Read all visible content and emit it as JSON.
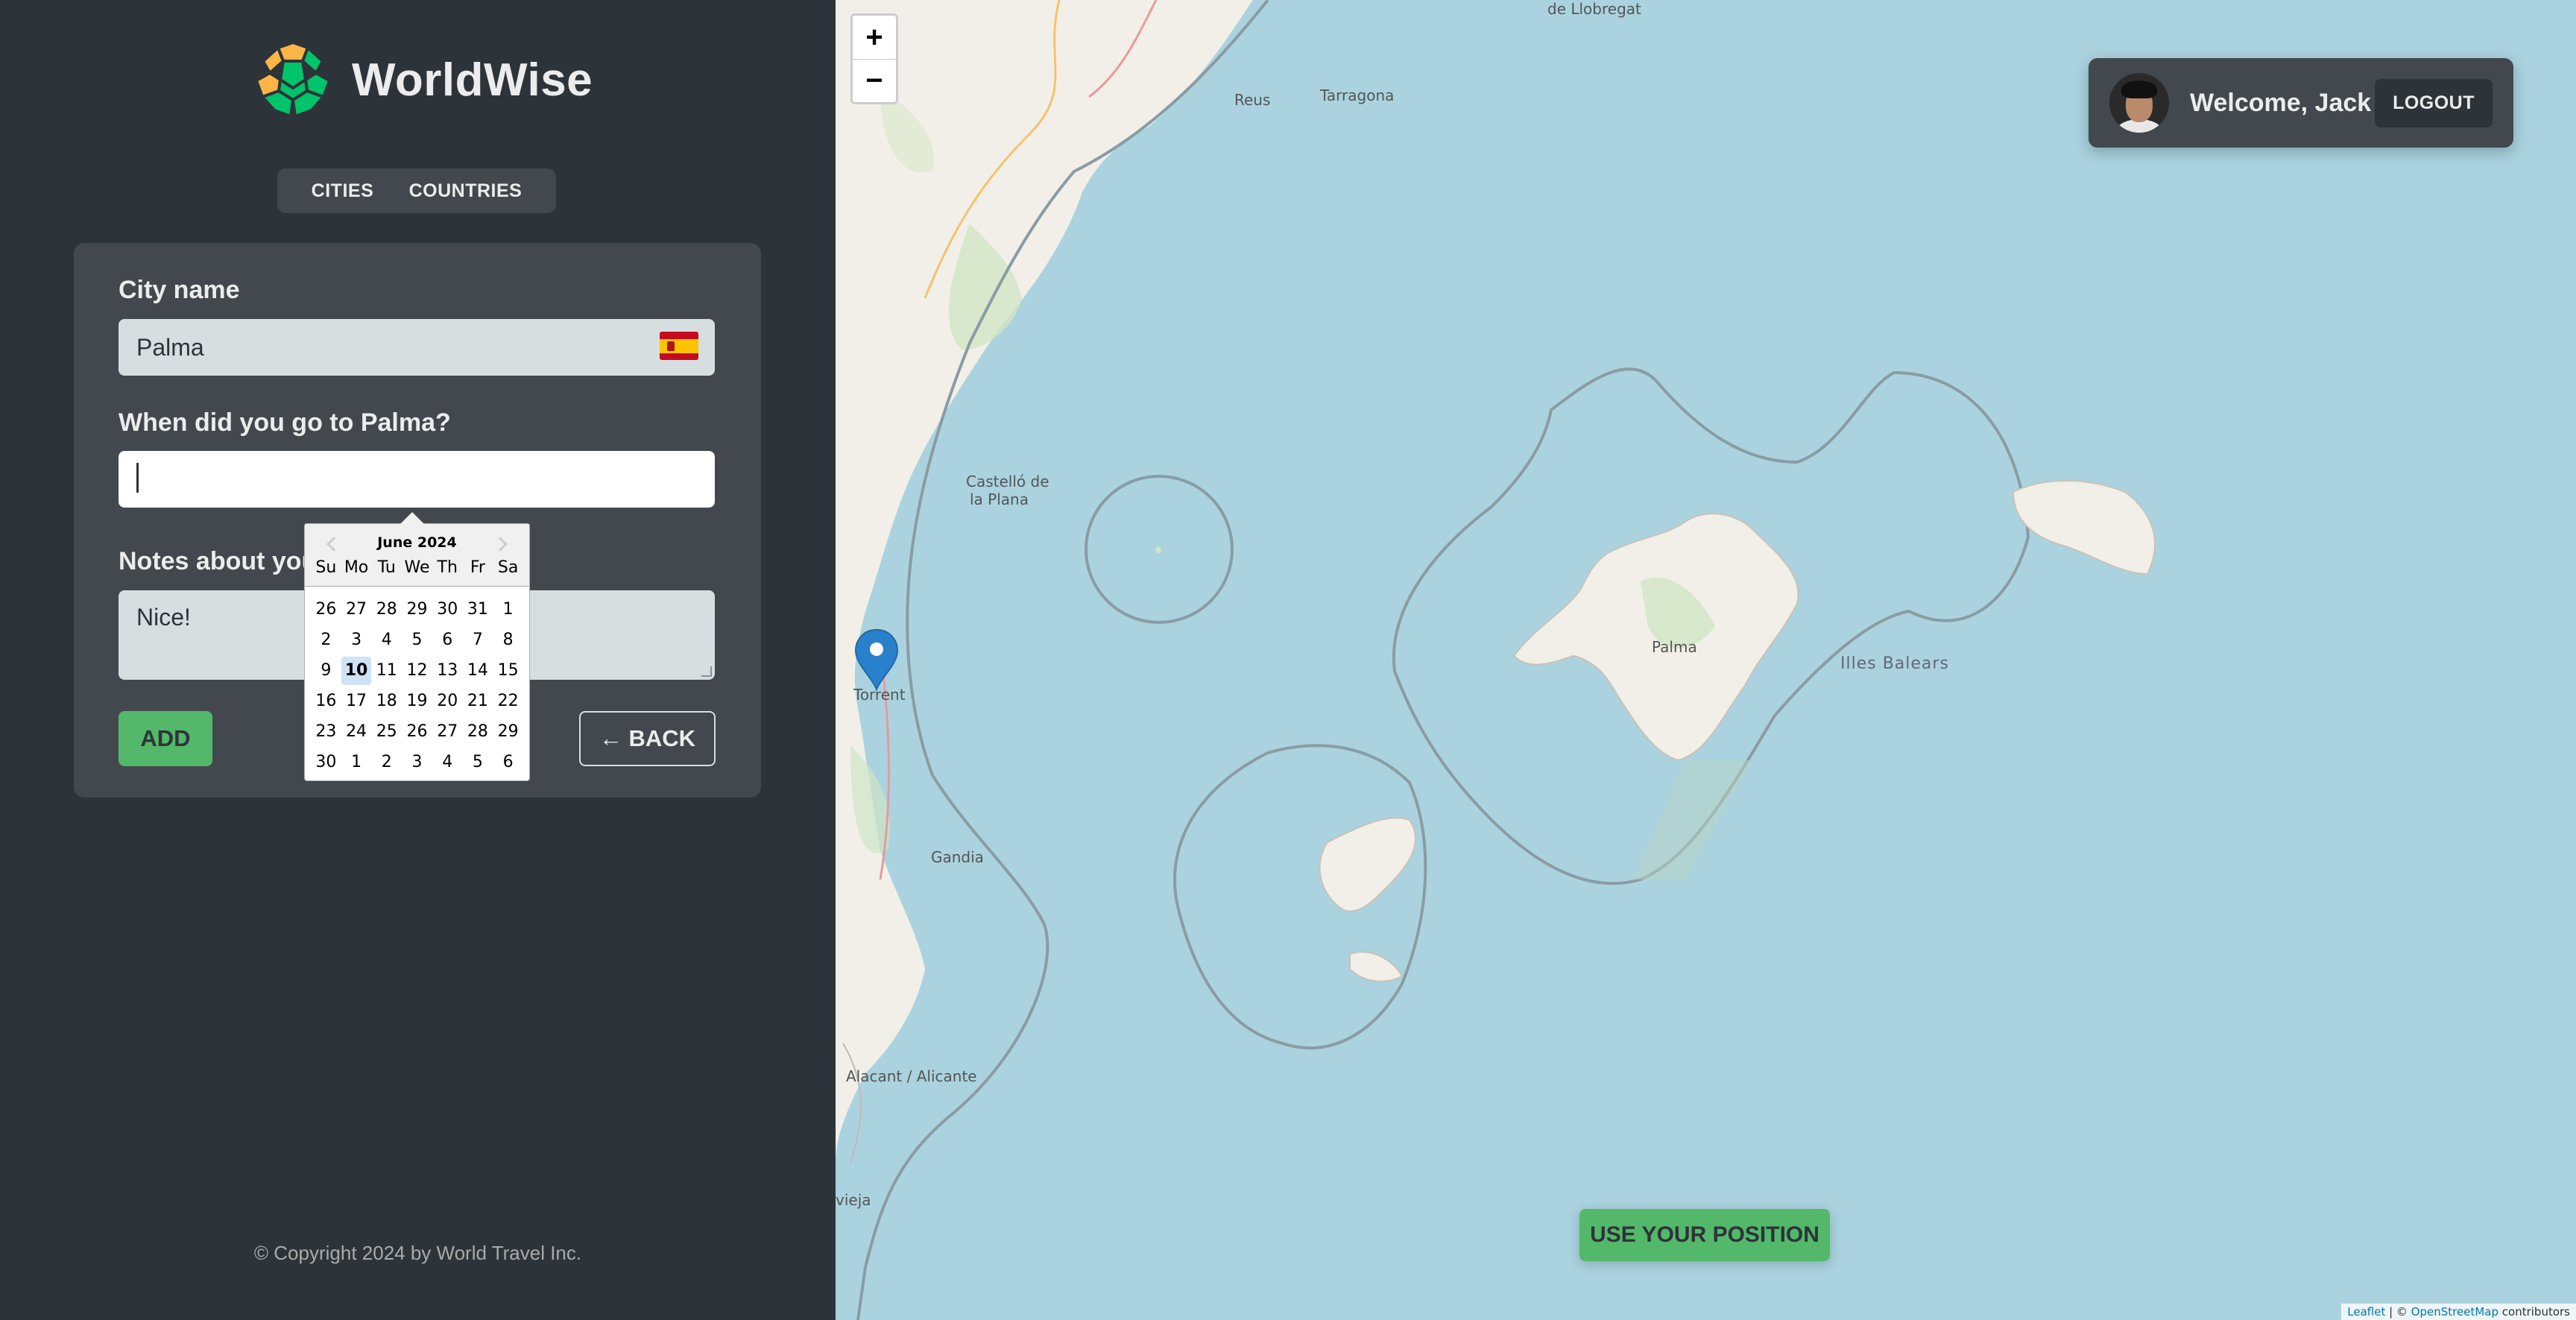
{
  "app": {
    "name": "WorldWise"
  },
  "nav": {
    "items": [
      "CITIES",
      "COUNTRIES"
    ]
  },
  "form": {
    "city_label": "City name",
    "city_value": "Palma",
    "date_label": "When did you go to Palma?",
    "date_value": "",
    "notes_label": "Notes about your trip to Palma",
    "notes_value": "Nice!",
    "add_label": "ADD",
    "back_label": "← BACK"
  },
  "datepicker": {
    "month": "June 2024",
    "weekdays": [
      "Su",
      "Mo",
      "Tu",
      "We",
      "Th",
      "Fr",
      "Sa"
    ],
    "days": [
      26,
      27,
      28,
      29,
      30,
      31,
      1,
      2,
      3,
      4,
      5,
      6,
      7,
      8,
      9,
      10,
      11,
      12,
      13,
      14,
      15,
      16,
      17,
      18,
      19,
      20,
      21,
      22,
      23,
      24,
      25,
      26,
      27,
      28,
      29,
      30,
      1,
      2,
      3,
      4,
      5,
      6
    ],
    "today": 10
  },
  "footer": {
    "copyright": "© Copyright 2024 by World Travel Inc."
  },
  "map": {
    "zoom_in": "+",
    "zoom_out": "−",
    "labels": {
      "llobregat": "de Llobregat",
      "reus": "Reus",
      "tarragona": "Tarragona",
      "castello": "Castelló de",
      "castello2": "la Plana",
      "torrent": "Torrent",
      "gandia": "Gandia",
      "alacant": "Alacant / Alicante",
      "vieja": "vieja",
      "palma": "Palma",
      "baleares": "Illes Balears"
    },
    "use_position": "USE YOUR POSITION",
    "attribution_leaflet": "Leaflet",
    "attribution_sep": " | © ",
    "attribution_osm": "OpenStreetMap",
    "attribution_end": " contributors"
  },
  "user": {
    "welcome": "Welcome, Jack",
    "logout": "LOGOUT"
  },
  "colors": {
    "brand_green": "#53b86a",
    "dark": "#2d3439",
    "panel": "#42484d",
    "sea": "#aad3df"
  }
}
